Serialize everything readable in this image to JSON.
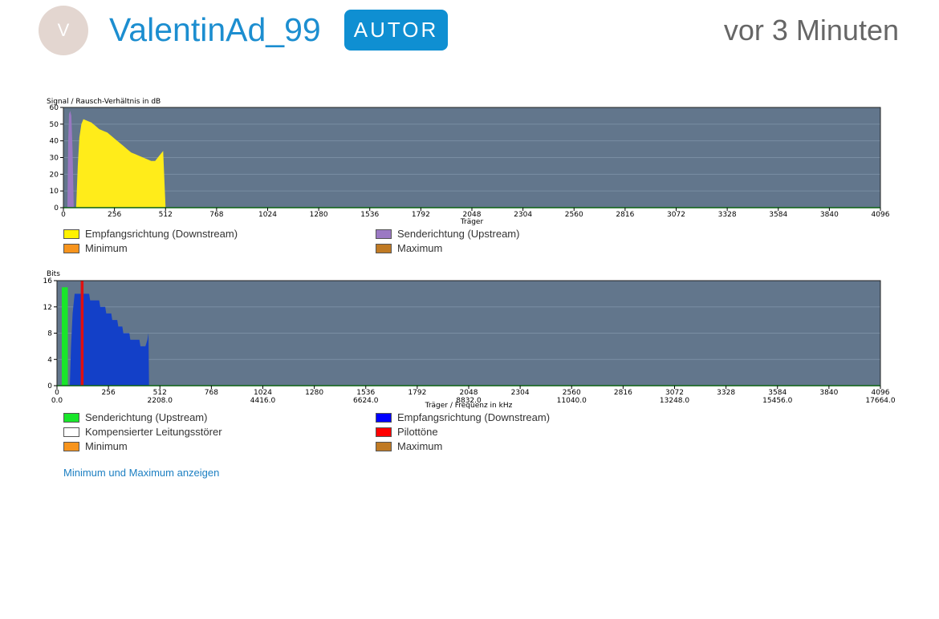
{
  "post": {
    "avatar_initial": "V",
    "username": "ValentinAd_99",
    "badge": "AUTOR",
    "timestamp": "vor 3 Minuten"
  },
  "chart_data": [
    {
      "type": "area",
      "ylabel": "Signal / Rausch-Verhältnis in dB",
      "xlabel": "Träger",
      "xlim": [
        0,
        4096
      ],
      "ylim": [
        0,
        60
      ],
      "x_ticks": [
        "0",
        "256",
        "512",
        "768",
        "1024",
        "1280",
        "1536",
        "1792",
        "2048",
        "2304",
        "2560",
        "2816",
        "3072",
        "3328",
        "3584",
        "3840",
        "4096"
      ],
      "y_ticks": [
        "0",
        "10",
        "20",
        "30",
        "40",
        "50",
        "60"
      ],
      "grid": true,
      "series": [
        {
          "name": "Empfangsrichtung (Downstream)",
          "color": "#ffec1a",
          "points": [
            [
              64,
              0
            ],
            [
              72,
              25
            ],
            [
              80,
              42
            ],
            [
              90,
              50
            ],
            [
              100,
              53
            ],
            [
              120,
              52
            ],
            [
              140,
              51
            ],
            [
              160,
              49
            ],
            [
              180,
              47
            ],
            [
              200,
              46
            ],
            [
              220,
              45
            ],
            [
              240,
              43
            ],
            [
              260,
              41
            ],
            [
              280,
              39
            ],
            [
              300,
              37
            ],
            [
              320,
              35
            ],
            [
              340,
              33
            ],
            [
              360,
              32
            ],
            [
              380,
              31
            ],
            [
              400,
              30
            ],
            [
              420,
              29
            ],
            [
              440,
              28
            ],
            [
              460,
              28
            ],
            [
              480,
              31
            ],
            [
              500,
              34
            ],
            [
              505,
              20
            ],
            [
              512,
              0
            ]
          ]
        },
        {
          "name": "Senderichtung (Upstream)",
          "color": "#9a78c2",
          "points": [
            [
              20,
              0
            ],
            [
              24,
              40
            ],
            [
              28,
              56
            ],
            [
              34,
              58
            ],
            [
              40,
              55
            ],
            [
              46,
              35
            ],
            [
              52,
              0
            ]
          ]
        }
      ],
      "legend": [
        {
          "label": "Empfangsrichtung (Downstream)",
          "color": "#fff200"
        },
        {
          "label": "Senderichtung (Upstream)",
          "color": "#9b79c4"
        },
        {
          "label": "Minimum",
          "color": "#f7941d"
        },
        {
          "label": "Maximum",
          "color": "#c07a24"
        }
      ]
    },
    {
      "type": "area",
      "ylabel": "Bits",
      "xlabel": "Träger / Frequenz in kHz",
      "xlim": [
        0,
        4096
      ],
      "ylim": [
        0,
        16
      ],
      "x_ticks": [
        "0",
        "256",
        "512",
        "768",
        "1024",
        "1280",
        "1536",
        "1792",
        "2048",
        "2304",
        "2560",
        "2816",
        "3072",
        "3328",
        "3584",
        "3840",
        "4096"
      ],
      "x_freq_ticks": [
        "0.0",
        "2208.0",
        "4416.0",
        "6624.0",
        "8832.0",
        "11040.0",
        "13248.0",
        "15456.0",
        "17664.0"
      ],
      "y_ticks": [
        "0",
        "4",
        "8",
        "12",
        "16"
      ],
      "grid": true,
      "series": [
        {
          "name": "Empfangsrichtung (Downstream)",
          "color": "#1340c8",
          "points": [
            [
              64,
              0
            ],
            [
              70,
              6
            ],
            [
              78,
              11
            ],
            [
              88,
              14
            ],
            [
              160,
              14
            ],
            [
              165,
              13
            ],
            [
              210,
              13
            ],
            [
              215,
              12
            ],
            [
              240,
              12
            ],
            [
              245,
              11
            ],
            [
              270,
              11
            ],
            [
              275,
              10
            ],
            [
              300,
              10
            ],
            [
              305,
              9
            ],
            [
              325,
              9
            ],
            [
              330,
              8
            ],
            [
              360,
              8
            ],
            [
              365,
              7
            ],
            [
              410,
              7
            ],
            [
              415,
              6
            ],
            [
              440,
              6
            ],
            [
              450,
              7
            ],
            [
              455,
              8
            ],
            [
              458,
              0
            ]
          ]
        },
        {
          "name": "Senderichtung (Upstream)",
          "color": "#19e62a",
          "points": [
            [
              24,
              0
            ],
            [
              24,
              15
            ],
            [
              54,
              15
            ],
            [
              54,
              0
            ]
          ]
        },
        {
          "name": "Pilottöne",
          "color": "#e01010",
          "points": [
            [
              118,
              0
            ],
            [
              118,
              16
            ],
            [
              132,
              16
            ],
            [
              132,
              0
            ]
          ]
        }
      ],
      "legend": [
        {
          "label": "Senderichtung (Upstream)",
          "color": "#19e62a"
        },
        {
          "label": "Empfangsrichtung (Downstream)",
          "color": "#0000ff"
        },
        {
          "label": "Kompensierter Leitungsstörer",
          "color": "#ffffff"
        },
        {
          "label": "Pilottöne",
          "color": "#ff0000"
        },
        {
          "label": "Minimum",
          "color": "#f7941d"
        },
        {
          "label": "Maximum",
          "color": "#c07a24"
        }
      ]
    }
  ],
  "toggle_link": "Minimum und Maximum anzeigen"
}
